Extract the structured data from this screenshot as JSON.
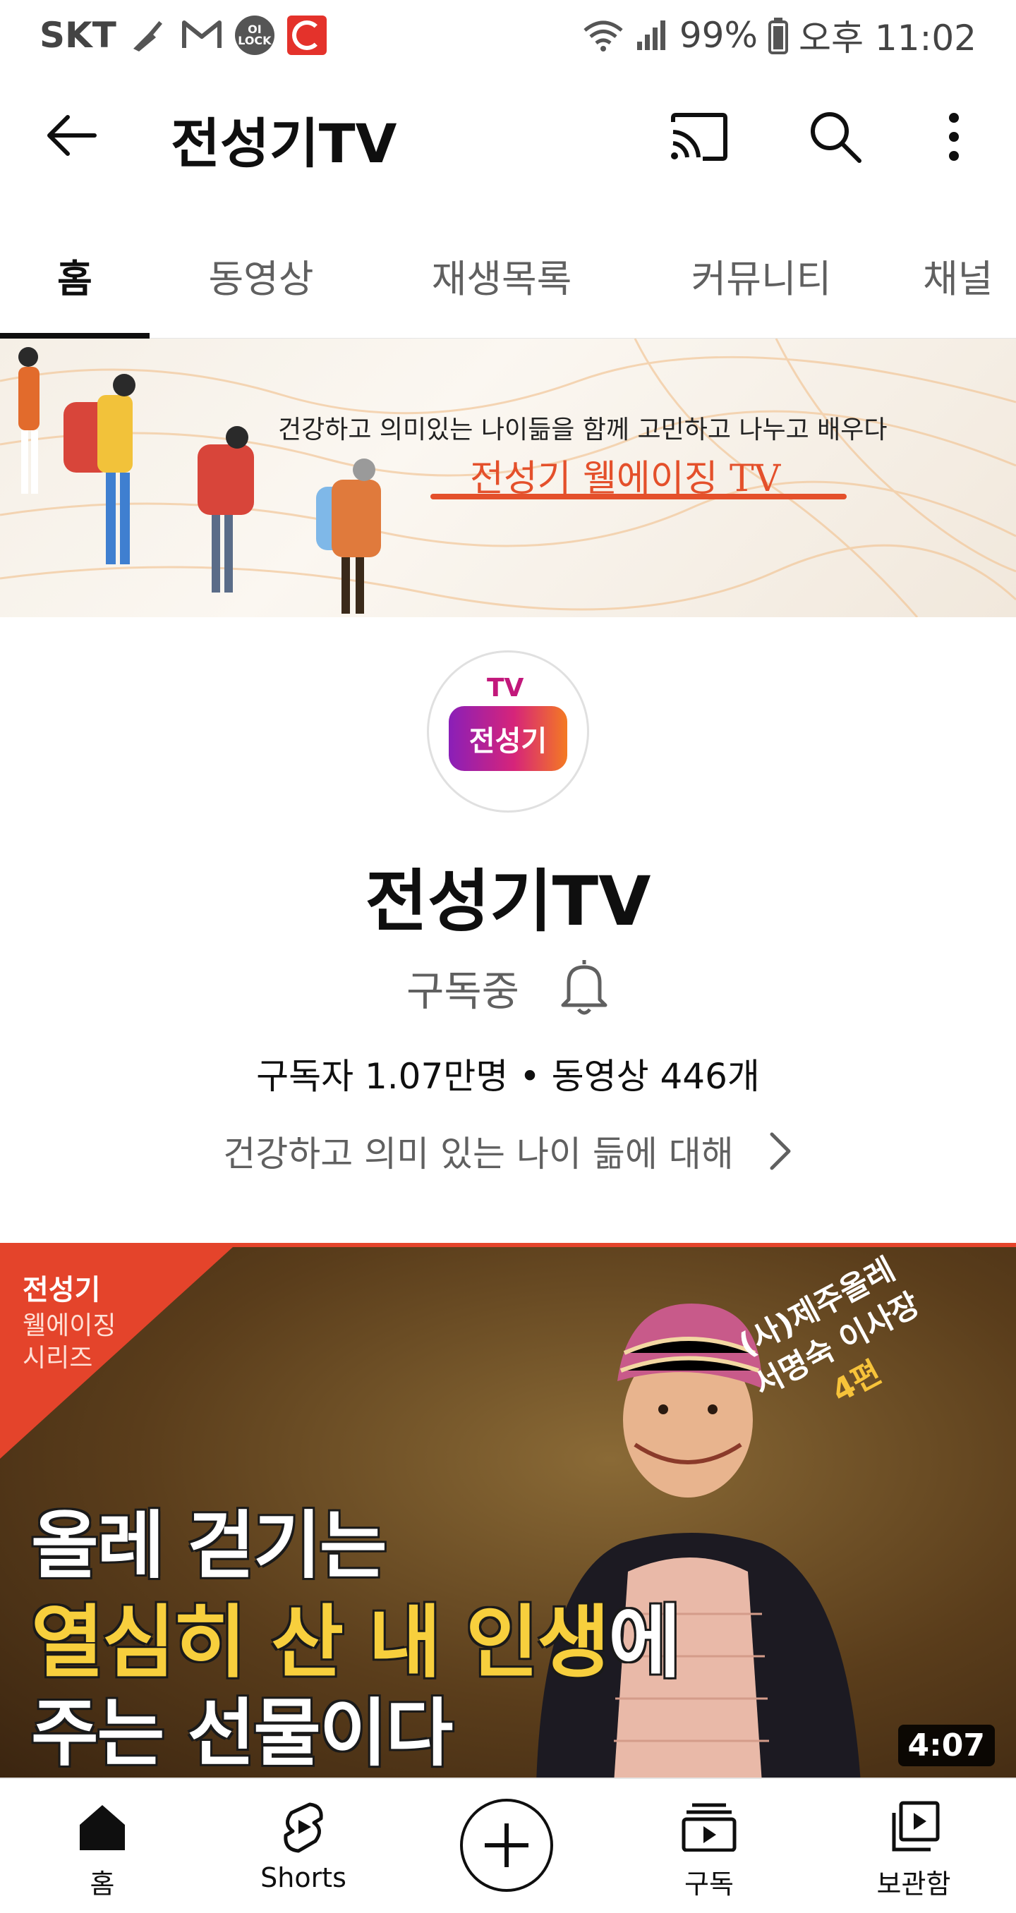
{
  "status_bar": {
    "carrier": "SKT",
    "lock_badge": "OI LOCK",
    "battery": "99%",
    "time": "오후 11:02"
  },
  "app_bar": {
    "title": "전성기TV",
    "icons": [
      "back-arrow-icon",
      "cast-icon",
      "search-icon",
      "more-vert-icon"
    ]
  },
  "tabs": [
    {
      "label": "홈",
      "active": true
    },
    {
      "label": "동영상",
      "active": false
    },
    {
      "label": "재생목록",
      "active": false
    },
    {
      "label": "커뮤니티",
      "active": false
    },
    {
      "label": "채널",
      "active": false
    }
  ],
  "banner": {
    "tagline": "건강하고 의미있는 나이듦을 함께 고민하고 나누고 배우다",
    "subtitle": "전성기 웰에이징 TV"
  },
  "channel": {
    "avatar_top": "TV",
    "avatar_text": "전성기",
    "name": "전성기TV",
    "subscribe_label": "구독중",
    "stats": "구독자 1.07만명 • 동영상 446개",
    "description": "건강하고 의미 있는 나이 듦에 대해"
  },
  "featured_video": {
    "series_brand": "전성기",
    "series_line2": "웰에이징",
    "series_line3": "시리즈",
    "side_line1": "(사)제주올레",
    "side_line2": "서명숙 이사장",
    "side_line3": "4편",
    "headline_line1": "올레 걷기는",
    "headline_line2_highlight": "열심히 산 내 인생",
    "headline_line2_rest": "에",
    "headline_line3": "주는 선물이다",
    "duration": "4:07"
  },
  "bottom_nav": [
    {
      "label": "홈",
      "icon": "home-icon"
    },
    {
      "label": "Shorts",
      "icon": "shorts-icon"
    },
    {
      "label": "",
      "icon": "create-icon"
    },
    {
      "label": "구독",
      "icon": "subscriptions-icon"
    },
    {
      "label": "보관함",
      "icon": "library-icon"
    }
  ],
  "colors": {
    "accent_red": "#e4442b",
    "banner_orange": "#e4502b",
    "headline_yellow": "#f7cf3d"
  }
}
